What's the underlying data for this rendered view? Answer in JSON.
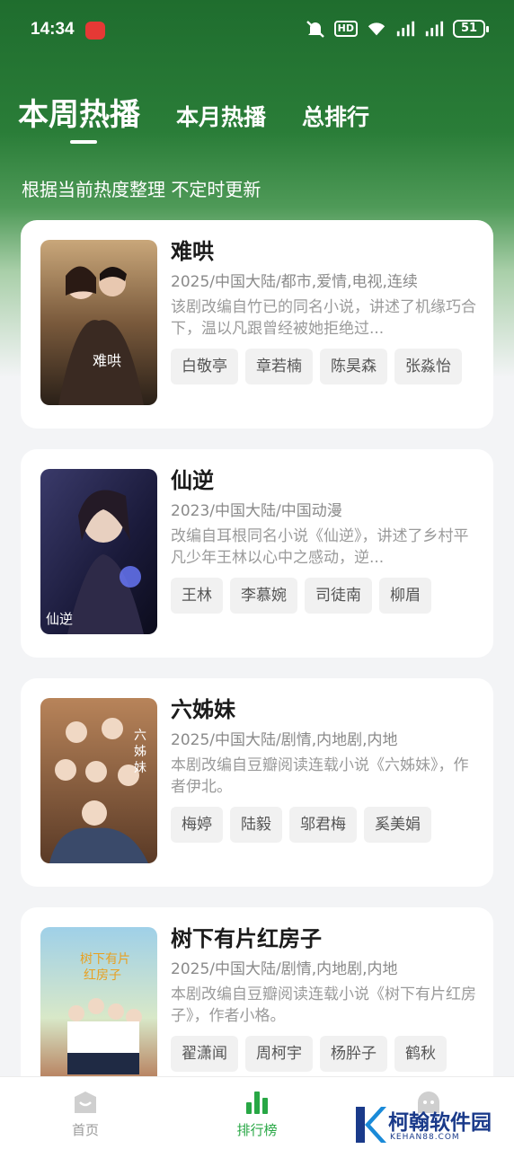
{
  "status": {
    "time": "14:34",
    "hd": "HD",
    "net1": "5G",
    "net2": "5G",
    "battery": "51"
  },
  "tabs": [
    {
      "label": "本周热播",
      "active": true
    },
    {
      "label": "本月热播",
      "active": false
    },
    {
      "label": "总排行",
      "active": false
    }
  ],
  "subtitle": "根据当前热度整理 不定时更新",
  "cards": [
    {
      "title": "难哄",
      "meta": "2025/中国大陆/都市,爱情,电视,连续",
      "desc": "该剧改编自竹已的同名小说，讲述了机缘巧合下，温以凡跟曾经被她拒绝过...",
      "cast": [
        "白敬亭",
        "章若楠",
        "陈昊森",
        "张淼怡"
      ]
    },
    {
      "title": "仙逆",
      "meta": "2023/中国大陆/中国动漫",
      "desc": "改编自耳根同名小说《仙逆》，讲述了乡村平凡少年王林以心中之感动，逆...",
      "cast": [
        "王林",
        "李慕婉",
        "司徒南",
        "柳眉"
      ]
    },
    {
      "title": "六姊妹",
      "meta": "2025/中国大陆/剧情,内地剧,内地",
      "desc": "本剧改编自豆瓣阅读连载小说《六姊妹》，作者伊北。",
      "cast": [
        "梅婷",
        "陆毅",
        "邬君梅",
        "奚美娟"
      ]
    },
    {
      "title": "树下有片红房子",
      "meta": "2025/中国大陆/剧情,内地剧,内地",
      "desc": "本剧改编自豆瓣阅读连载小说《树下有片红房子》，作者小格。",
      "cast": [
        "翟潇闻",
        "周柯宇",
        "杨肸子",
        "鹤秋"
      ]
    }
  ],
  "nav": [
    {
      "label": "首页",
      "icon": "home-icon",
      "active": false
    },
    {
      "label": "排行榜",
      "icon": "ranking-icon",
      "active": true
    },
    {
      "label": "我的",
      "icon": "profile-icon",
      "active": false
    }
  ],
  "watermark": {
    "text": "柯翰软件园",
    "sub": "KEHAN88.COM"
  },
  "colors": {
    "accent": "#28a745",
    "header_green": "#1f6d2e"
  }
}
